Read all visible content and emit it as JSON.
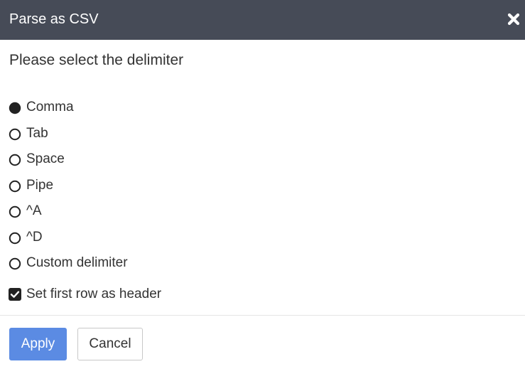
{
  "dialog": {
    "title": "Parse as CSV",
    "close_icon": "close-x-icon",
    "prompt": "Please select the delimiter"
  },
  "delimiters": {
    "selected": "Comma",
    "items": [
      {
        "label": "Comma",
        "checked": true
      },
      {
        "label": "Tab",
        "checked": false
      },
      {
        "label": "Space",
        "checked": false
      },
      {
        "label": "Pipe",
        "checked": false
      },
      {
        "label": "^A",
        "checked": false
      },
      {
        "label": "^D",
        "checked": false
      },
      {
        "label": "Custom delimiter",
        "checked": false
      }
    ]
  },
  "header_option": {
    "label": "Set first row as header",
    "checked": true
  },
  "buttons": {
    "apply_label": "Apply",
    "cancel_label": "Cancel"
  },
  "colors": {
    "titlebar": "#464b57",
    "accent": "#5b8be3",
    "text": "#333333",
    "radio_fill": "#222222"
  }
}
